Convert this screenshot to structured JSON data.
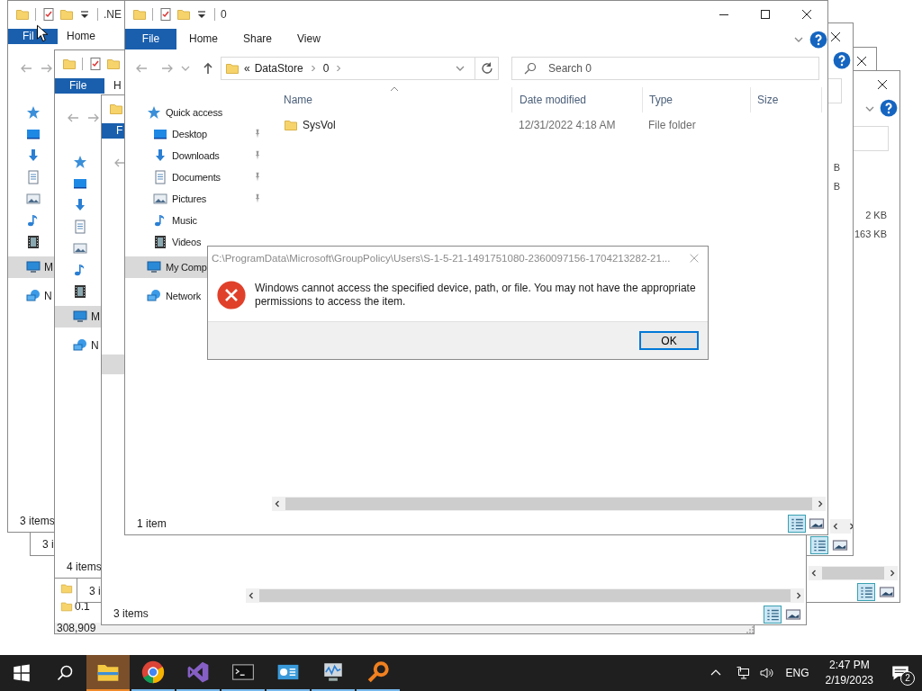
{
  "background_windows": [
    {
      "kind": "explorer",
      "tabs": [
        {
          "label": "F",
          "kind": "file"
        }
      ],
      "nav": [
        {
          "selected": true
        }
      ],
      "status": "3 items",
      "views": [
        {
          "selected": true
        },
        {
          "selected": false
        }
      ]
    },
    {
      "kind": "explorer",
      "tabs": [
        {
          "label": "File",
          "kind": "file"
        },
        {
          "label": "H",
          "kind": "tab"
        }
      ],
      "nav": [
        {
          "selected": false
        },
        {
          "selected": false
        },
        {
          "selected": false
        },
        {
          "selected": false
        },
        {
          "selected": false
        },
        {
          "selected": false
        },
        {
          "selected": false
        },
        {
          "label": "M",
          "selected": true
        },
        {
          "label": "N",
          "selected": false
        }
      ],
      "status": "4 items"
    },
    {
      "kind": "explorer",
      "status": "3 i"
    },
    {
      "kind": "listing",
      "rows": [
        {
          "label": "0.1"
        }
      ],
      "status": "308,909"
    },
    {
      "kind": "explorer",
      "sizes": [
        "B",
        "B"
      ],
      "views": [
        {
          "selected": true
        },
        {
          "selected": false
        }
      ]
    },
    {
      "kind": "explorer",
      "sizes": [
        "2 KB",
        "163 KB"
      ],
      "views": [
        {
          "selected": true
        },
        {
          "selected": false
        }
      ]
    },
    {
      "kind": "explorer"
    },
    {
      "kind": "explorer",
      "title": ".NE",
      "tabs": [
        {
          "label": "Fil",
          "kind": "file"
        },
        {
          "label": "Home",
          "kind": "tab"
        }
      ],
      "nav": [
        {
          "selected": false
        },
        {
          "selected": false
        },
        {
          "selected": false
        },
        {
          "selected": false
        },
        {
          "selected": false
        },
        {
          "selected": false
        },
        {
          "selected": false
        },
        {
          "label": "M",
          "selected": true
        },
        {
          "label": "N",
          "selected": false
        }
      ],
      "status": "3 items"
    },
    {
      "kind": "explorer",
      "status": "3 i"
    }
  ],
  "main_window": {
    "title": "0",
    "tabs": [
      {
        "label": "File",
        "kind": "file"
      },
      {
        "label": "Home",
        "kind": "tab"
      },
      {
        "label": "Share",
        "kind": "tab"
      },
      {
        "label": "View",
        "kind": "tab"
      }
    ],
    "address": {
      "overflow": "«",
      "segments": [
        "DataStore",
        "0"
      ]
    },
    "search": {
      "placeholder": "Search 0"
    },
    "nav": [
      {
        "label": "Quick access",
        "selected": false,
        "children": [
          {
            "label": "Desktop",
            "pinned": true,
            "selected": false
          },
          {
            "label": "Downloads",
            "pinned": true,
            "selected": false
          },
          {
            "label": "Documents",
            "pinned": true,
            "selected": false
          },
          {
            "label": "Pictures",
            "pinned": true,
            "selected": false
          },
          {
            "label": "Music",
            "pinned": false,
            "selected": false
          },
          {
            "label": "Videos",
            "pinned": false,
            "selected": false
          }
        ]
      },
      {
        "label": "My Comp",
        "selected": true
      },
      {
        "label": "Network",
        "selected": false
      }
    ],
    "columns": [
      {
        "label": "Name",
        "sorted": true
      },
      {
        "label": "Date modified",
        "sorted": false
      },
      {
        "label": "Type",
        "sorted": false
      },
      {
        "label": "Size",
        "sorted": false
      }
    ],
    "rows": [
      {
        "name": "SysVol",
        "date": "12/31/2022 4:18 AM",
        "type": "File folder"
      }
    ],
    "status": "1 item",
    "views": [
      {
        "selected": true
      },
      {
        "selected": false
      }
    ]
  },
  "dialog": {
    "title": "C:\\ProgramData\\Microsoft\\GroupPolicy\\Users\\S-1-5-21-1491751080-2360097156-1704213282-21...",
    "message": "Windows cannot access the specified device, path, or file. You may not have the appropriate permissions to access the item.",
    "button": "OK"
  },
  "taskbar": {
    "apps": [
      {
        "selected": true
      },
      {
        "selected": false
      },
      {
        "selected": false
      },
      {
        "selected": false
      },
      {
        "selected": false
      },
      {
        "selected": false
      },
      {
        "selected": false
      }
    ],
    "language": "ENG",
    "time": "2:47 PM",
    "date": "2/19/2023",
    "notifications": "2"
  }
}
